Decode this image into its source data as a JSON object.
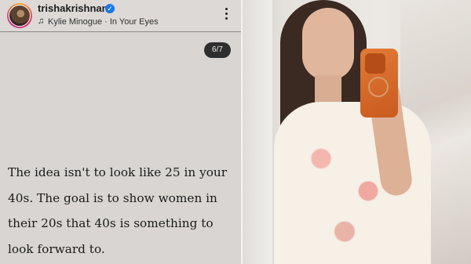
{
  "post": {
    "username": "trishakrishnan",
    "verified_mark": "✓",
    "audio": "Kylie Minogue · In Your Eyes",
    "music_icon": "♫",
    "page_indicator": "6/7",
    "quote_lines": [
      "The idea isn't to look like 25 in your",
      "40s. The goal is to show women in",
      "their 20s that 40s is something to",
      "look forward to."
    ]
  },
  "icons": {
    "verified": "verified-badge-icon",
    "music": "music-note-icon",
    "more": "more-vertical-icon"
  },
  "colors": {
    "left_background": "#d8d5d2",
    "verified_blue": "#1877f2",
    "badge_background": "#2e2e2e",
    "phone_case": "#e27a37"
  }
}
